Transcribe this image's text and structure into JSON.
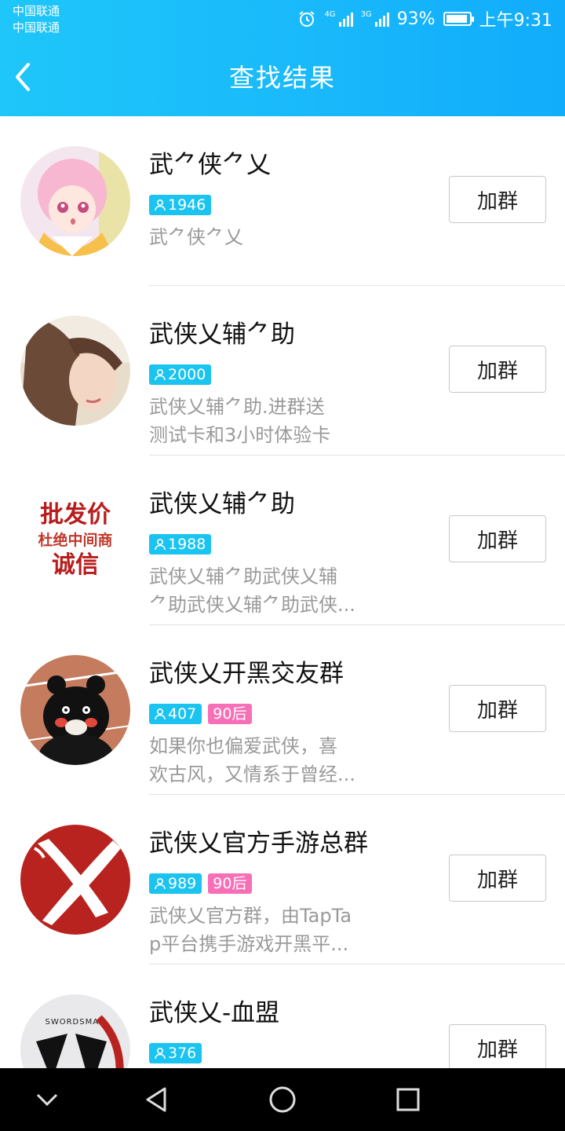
{
  "status_bar": {
    "carrier_1": "中国联通",
    "carrier_2": "中国联通",
    "net_1": "4G",
    "net_2": "3G",
    "battery_percent": "93%",
    "battery_level": 0.93,
    "time": "上午9:31",
    "icons": [
      "alarm-icon",
      "signal-icon",
      "battery-icon"
    ]
  },
  "header": {
    "title": "查找结果",
    "back_icon": "chevron-left-icon"
  },
  "results": [
    {
      "name": "武⺈侠⺈乂",
      "members": "1946",
      "tag": "",
      "desc_lines": [
        "武⺈侠⺈乂"
      ],
      "join_label": "加群"
    },
    {
      "name": "武侠乂辅⺈助",
      "members": "2000",
      "tag": "",
      "desc_lines": [
        "武侠乂辅⺈助.进群送",
        "测试卡和3小时体验卡"
      ],
      "join_label": "加群"
    },
    {
      "name": "武侠乂辅⺈助",
      "members": "1988",
      "tag": "",
      "avatar_text": [
        "批发价",
        "杜绝中间商",
        "诚信"
      ],
      "desc_lines": [
        "武侠乂辅⺈助武侠乂辅",
        "⺈助武侠乂辅⺈助武侠..."
      ],
      "join_label": "加群"
    },
    {
      "name": "武侠乂开黑交友群",
      "members": "407",
      "tag": "90后",
      "desc_lines": [
        "如果你也偏爱武侠，喜",
        "欢古风，又情系于曾经..."
      ],
      "join_label": "加群"
    },
    {
      "name": "武侠乂官方手游总群",
      "members": "989",
      "tag": "90后",
      "desc_lines": [
        "武侠乂官方群，由TapTa",
        "p平台携手游戏开黑平..."
      ],
      "join_label": "加群"
    },
    {
      "name": "武侠乂-血盟",
      "members": "376",
      "tag": "",
      "avatar_text": [
        "SWORDSMAN"
      ],
      "desc_lines": [
        ""
      ],
      "join_label": "加群"
    }
  ],
  "colors": {
    "header_start": "#1ec6f9",
    "header_end": "#11acfb",
    "member_badge": "#1ac3f0",
    "age_badge": "#f76fb6"
  },
  "system_nav": {
    "icons": [
      "nav-collapse-icon",
      "nav-back-icon",
      "nav-home-icon",
      "nav-recents-icon"
    ]
  }
}
